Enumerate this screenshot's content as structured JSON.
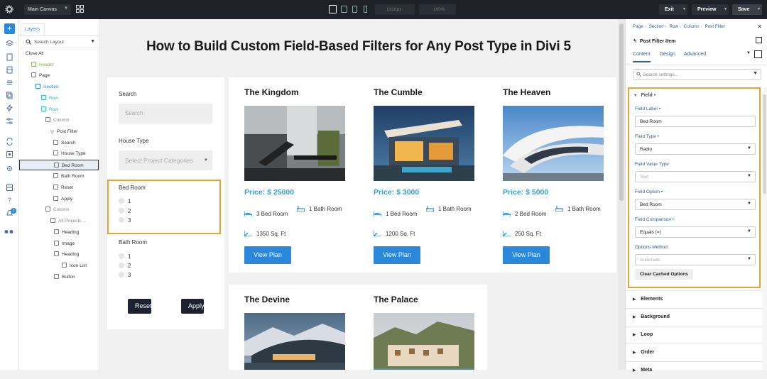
{
  "topbar": {
    "canvas_label": "Main Canvas",
    "width_value": "1310px",
    "zoom_value": "100%",
    "exit_label": "Exit",
    "preview_label": "Preview",
    "save_label": "Save"
  },
  "layers": {
    "tab_label": "Layers",
    "search_placeholder": "Search Layout",
    "close_all": "Close All",
    "items": [
      {
        "label": "Header"
      },
      {
        "label": "Page"
      },
      {
        "label": "Section"
      },
      {
        "label": "Row"
      },
      {
        "label": "Row"
      },
      {
        "label": "Column"
      },
      {
        "label": "Post Filter"
      },
      {
        "label": "Search"
      },
      {
        "label": "House Type"
      },
      {
        "label": "Bed Room"
      },
      {
        "label": "Bath Room"
      },
      {
        "label": "Reset"
      },
      {
        "label": "Apply"
      },
      {
        "label": "Column"
      },
      {
        "label": "All Projects ..."
      },
      {
        "label": "Heading"
      },
      {
        "label": "Image"
      },
      {
        "label": "Heading"
      },
      {
        "label": "Icon List"
      },
      {
        "label": "Button"
      }
    ]
  },
  "page": {
    "title": "How to Build Custom Field-Based Filters for Any Post Type in Divi 5"
  },
  "filter": {
    "search_label": "Search",
    "search_placeholder": "Search",
    "house_label": "House Type",
    "house_placeholder": "Select Project Categories",
    "bed_label": "Bed Room",
    "bed_options": [
      "1",
      "2",
      "3"
    ],
    "bath_label": "Bath Room",
    "bath_options": [
      "1",
      "2",
      "3"
    ],
    "reset_label": "Reset",
    "apply_label": "Apply"
  },
  "cards": [
    {
      "title": "The Kingdom",
      "price": "Price: $ 25000",
      "beds": "3 Bed Room",
      "baths": "1 Bath Room",
      "area": "1350 Sq. Ft",
      "button": "View Plan"
    },
    {
      "title": "The Cumble",
      "price": "Price: $ 3000",
      "beds": "1 Bed Room",
      "baths": "1 Bath Room",
      "area": "1200 Sq. Ft",
      "button": "View Plan"
    },
    {
      "title": "The Heaven",
      "price": "Price: $ 5000",
      "beds": "2 Bed Room",
      "baths": "1 Bath Room",
      "area": "250 Sq. Ft",
      "button": "View Plan"
    },
    {
      "title": "The Devine"
    },
    {
      "title": "The Palace"
    }
  ],
  "settings": {
    "breadcrumb": [
      "Page",
      "Section",
      "Row",
      "Column",
      "Post Filter"
    ],
    "module_title": "Post Filter Item",
    "tabs": [
      "Content",
      "Design",
      "Advanced"
    ],
    "search_placeholder": "Search settings...",
    "field_heading": "Field",
    "field_label_label": "Field Label",
    "field_label_value": "Bed Room",
    "field_type_label": "Field Type",
    "field_type_value": "Radio",
    "field_value_type_label": "Field Value Type",
    "field_value_type_value": "Text",
    "field_option_label": "Field Option",
    "field_option_value": "Bed Room",
    "field_comparison_label": "Field Comparison",
    "field_comparison_value": "Equals (=)",
    "options_method_label": "Options Method",
    "options_method_value": "Automatic",
    "clear_cache_label": "Clear Cached Options",
    "groups": [
      "Elements",
      "Background",
      "Loop",
      "Order",
      "Meta"
    ]
  },
  "colors": {
    "accent": "#2b87da",
    "price": "#29a3d9",
    "highlight": "#f0a030",
    "topbar": "#1e2128"
  }
}
